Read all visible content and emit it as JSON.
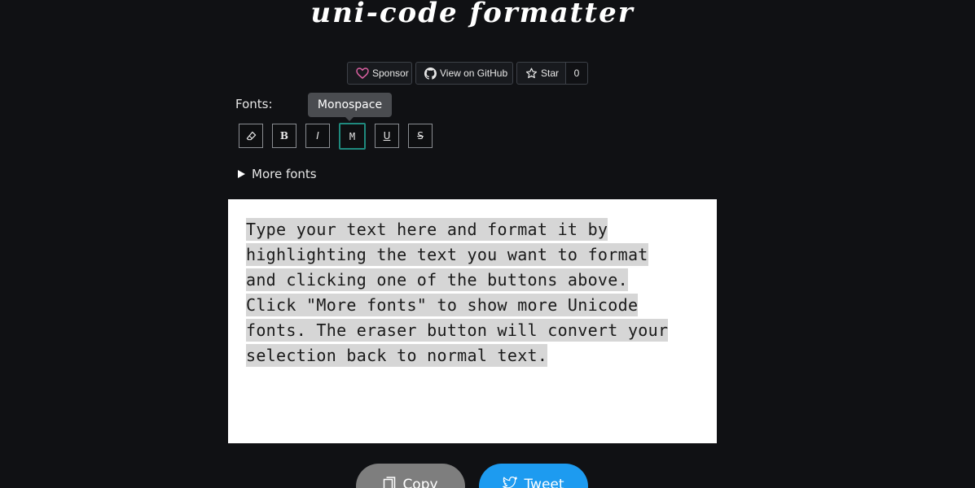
{
  "header": {
    "title": "uni-code formatter"
  },
  "github_buttons": {
    "sponsor_label": "Sponsor",
    "github_label": "View on GitHub",
    "star_label": "Star",
    "star_count": "0"
  },
  "fonts": {
    "label": "Fonts:",
    "tooltip": "Monospace",
    "buttons": [
      {
        "label": "",
        "name": "eraser"
      },
      {
        "label": "B",
        "name": "bold"
      },
      {
        "label": "I",
        "name": "italic"
      },
      {
        "label": "M",
        "name": "monospace"
      },
      {
        "label": "U",
        "name": "underline"
      },
      {
        "label": "S",
        "name": "strikethrough"
      }
    ],
    "active": "monospace",
    "more_fonts_label": "More fonts"
  },
  "editor": {
    "lines": [
      "Type your text here and format it by",
      "highlighting the text you want to format",
      "and clicking one of the buttons above.",
      "Click \"More fonts\" to show more Unicode",
      "fonts. The eraser button will convert your",
      "selection back to normal text."
    ]
  },
  "actions": {
    "copy_label": "Copy",
    "tweet_label": "Tweet"
  },
  "colors": {
    "background": "#101114",
    "active_border": "#1f8a7e",
    "copy_button": "#7e7e7e",
    "tweet_button": "#1d9bf0",
    "sponsor_heart": "#db61a2"
  }
}
